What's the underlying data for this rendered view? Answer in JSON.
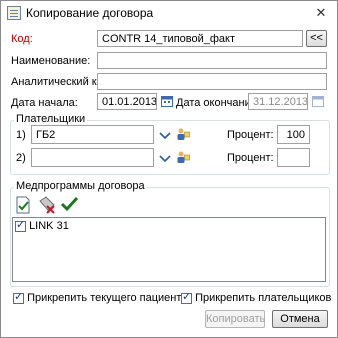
{
  "window": {
    "title": "Копирование договора",
    "close_glyph": "✕"
  },
  "form": {
    "code_label": "Код:",
    "code_value": "CONTR 14_типовой_факт",
    "code_button": "<<",
    "name_label": "Наименование:",
    "name_value": "",
    "analytic_label": "Аналитический код:",
    "analytic_value": "",
    "start_label": "Дата начала:",
    "start_value": "01.01.2013",
    "end_label": "Дата окончания:",
    "end_value": "31.12.2013"
  },
  "payers": {
    "title": "Плательщики",
    "rows": [
      {
        "num": "1)",
        "value": "ГБ2",
        "percent_label": "Процент:",
        "percent_value": "100"
      },
      {
        "num": "2)",
        "value": "",
        "percent_label": "Процент:",
        "percent_value": ""
      }
    ]
  },
  "medprograms": {
    "title": "Медпрограммы договора",
    "items": [
      {
        "label": "LINK 31",
        "checked": true
      }
    ]
  },
  "footer": {
    "attach_patient": "Прикрепить текущего пациента",
    "attach_payers": "Прикрепить плательщиков",
    "copy_button": "Копировать",
    "cancel_button": "Отмена"
  },
  "colors": {
    "required_label": "#c00000",
    "check": "#1a7a1a",
    "remove": "#c02020"
  }
}
